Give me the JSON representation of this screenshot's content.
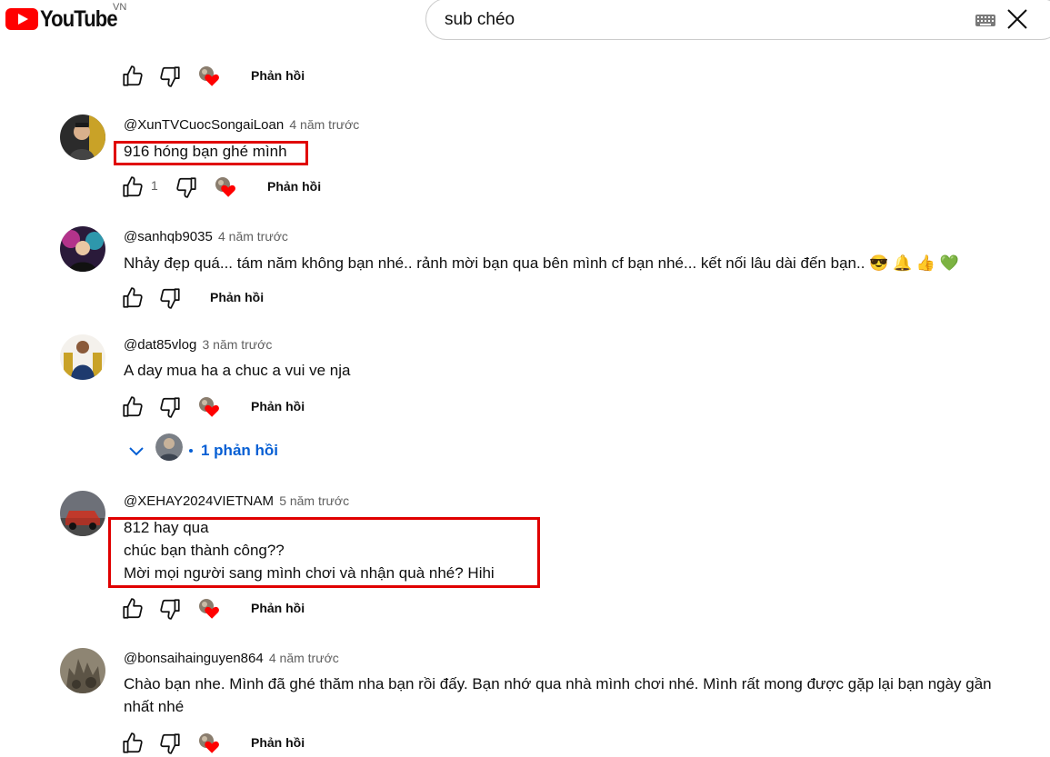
{
  "header": {
    "logo_text": "YouTube",
    "region": "VN",
    "search_query": "sub chéo"
  },
  "actions_labels": {
    "reply": "Phản hồi"
  },
  "comments": [
    {
      "author": "@XunTVCuocSongaiLoan",
      "time": "4 năm trước",
      "lines": [
        "916 hóng bạn ghé mình"
      ],
      "likes": "1",
      "highlighted": true
    },
    {
      "author": "@sanhqb9035",
      "time": "4 năm trước",
      "lines": [
        "Nhảy đẹp quá... tám năm không bạn nhé.. rảnh mời bạn qua bên mình cf bạn nhé... kết nối lâu dài đến bạn.. 😎 🔔 👍 💚"
      ],
      "likes": ""
    },
    {
      "author": "@dat85vlog",
      "time": "3 năm trước",
      "lines": [
        "A day mua ha a chuc a vui ve nja"
      ],
      "likes": "",
      "replies_label": "1 phản hồi"
    },
    {
      "author": "@XEHAY2024VIETNAM",
      "time": "5 năm trước",
      "lines": [
        "812  hay qua",
        "chúc bạn thành công??",
        "Mời mọi người sang mình chơi và nhận quà nhé? Hihi"
      ],
      "likes": "",
      "highlighted": true
    },
    {
      "author": "@bonsaihainguyen864",
      "time": "4 năm trước",
      "lines": [
        "Chào bạn nhe. Mình đã ghé thăm nha bạn rồi đấy. Bạn nhớ qua nhà mình chơi nhé. Mình rất mong được gặp lại bạn ngày gần",
        "nhất nhé"
      ],
      "likes": ""
    }
  ],
  "colors": {
    "brand": "#ff0000",
    "highlight_box": "#e00000",
    "link": "#065fd4"
  }
}
